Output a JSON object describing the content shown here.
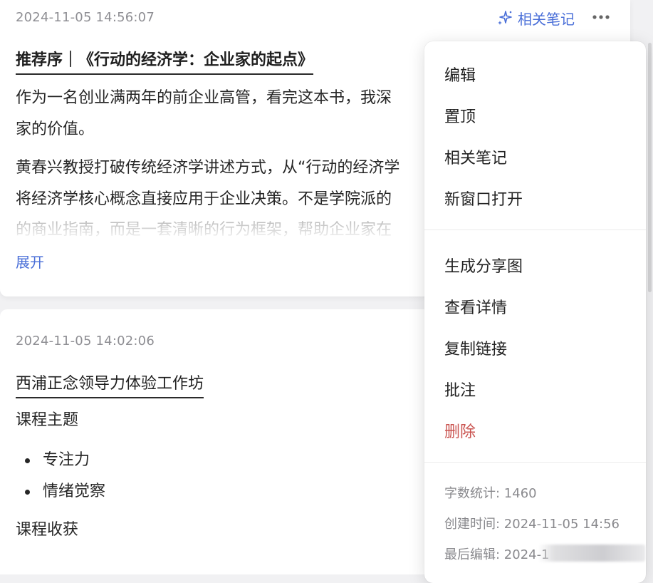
{
  "note1": {
    "timestamp": "2024-11-05 14:56:07",
    "title": "推荐序｜《行动的经济学：企业家的起点》",
    "para1_line1": "作为一名创业满两年的前企业高管，看完这本书，我深",
    "para1_line2": "家的价值。",
    "para2_line1": "黄春兴教授打破传统经济学讲述方式，从“行动的经济学",
    "para2_line2": "将经济学核心概念直接应用于企业决策。不是学院派的",
    "para2_line3_faded": "的商业指南，而是一套清晰的行为框架，帮助企业家在",
    "expand_label": "展开",
    "related_label": "相关笔记"
  },
  "note2": {
    "timestamp": "2024-11-05 14:02:06",
    "title": "西浦正念领导力体验工作坊",
    "section1": "课程主题",
    "bullets": [
      "专注力",
      "情绪觉察"
    ],
    "section2": "课程收获"
  },
  "menu": {
    "group1": [
      "编辑",
      "置顶",
      "相关笔记",
      "新窗口打开"
    ],
    "group2": [
      "生成分享图",
      "查看详情",
      "复制链接",
      "批注"
    ],
    "delete_label": "删除",
    "delete_color": "#c9524e",
    "word_count": "字数统计: 1460",
    "created": "创建时间: 2024-11-05 14:56",
    "last_edited": "最后编辑: 2024-1"
  },
  "colors": {
    "accent": "#4a6fd8",
    "danger": "#c9524e",
    "muted": "#8e8e93"
  },
  "icons": {
    "related": "sparkle-icon",
    "more": "more-dots-icon"
  }
}
